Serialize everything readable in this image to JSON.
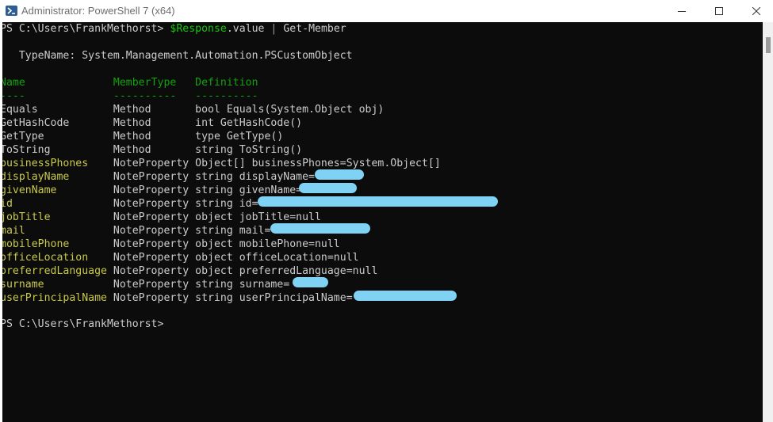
{
  "window": {
    "title": "Administrator: PowerShell 7 (x64)",
    "icon": "powershell-icon",
    "controls": [
      "minimize-icon",
      "maximize-icon",
      "close-icon"
    ]
  },
  "terminal": {
    "prompt1": "PS C:\\Users\\FrankMethorst> ",
    "command_var": "$Response",
    "command_prop": ".value",
    "command_pipe": " | ",
    "command_cmdlet": "Get-Member",
    "typename": "   TypeName: System.Management.Automation.PSCustomObject",
    "headers": {
      "name": "Name              ",
      "membertype": "MemberType   ",
      "definition": "Definition"
    },
    "dashes": {
      "name": "----              ",
      "membertype": "----------   ",
      "definition": "----------"
    },
    "rows": [
      {
        "name": "Equals            ",
        "type": "Method       ",
        "def": "bool Equals(System.Object obj)",
        "kind": "method"
      },
      {
        "name": "GetHashCode       ",
        "type": "Method       ",
        "def": "int GetHashCode()",
        "kind": "method"
      },
      {
        "name": "GetType           ",
        "type": "Method       ",
        "def": "type GetType()",
        "kind": "method"
      },
      {
        "name": "ToString          ",
        "type": "Method       ",
        "def": "string ToString()",
        "kind": "method"
      },
      {
        "name": "businessPhones    ",
        "type": "NoteProperty ",
        "def": "Object[] businessPhones=System.Object[]",
        "kind": "note"
      },
      {
        "name": "displayName       ",
        "type": "NoteProperty ",
        "def": "string displayName=",
        "kind": "note"
      },
      {
        "name": "givenName         ",
        "type": "NoteProperty ",
        "def": "string givenName=",
        "kind": "note"
      },
      {
        "name": "id                ",
        "type": "NoteProperty ",
        "def": "string id=",
        "kind": "note"
      },
      {
        "name": "jobTitle          ",
        "type": "NoteProperty ",
        "def": "object jobTitle=null",
        "kind": "note"
      },
      {
        "name": "mail              ",
        "type": "NoteProperty ",
        "def": "string mail=",
        "kind": "note"
      },
      {
        "name": "mobilePhone       ",
        "type": "NoteProperty ",
        "def": "object mobilePhone=null",
        "kind": "note"
      },
      {
        "name": "officeLocation    ",
        "type": "NoteProperty ",
        "def": "object officeLocation=null",
        "kind": "note"
      },
      {
        "name": "preferredLanguage ",
        "type": "NoteProperty ",
        "def": "object preferredLanguage=null",
        "kind": "note"
      },
      {
        "name": "surname           ",
        "type": "NoteProperty ",
        "def": "string surname=",
        "kind": "note"
      },
      {
        "name": "userPrincipalName ",
        "type": "NoteProperty ",
        "def": "string userPrincipalName=",
        "kind": "note"
      }
    ],
    "prompt2": "PS C:\\Users\\FrankMethorst>"
  },
  "colors": {
    "background": "#0c0c0c",
    "text": "#cccccc",
    "header": "#13a10e",
    "property_name": "#c8c84a",
    "variable": "#16c60c",
    "redaction": "#7fd2f4"
  }
}
